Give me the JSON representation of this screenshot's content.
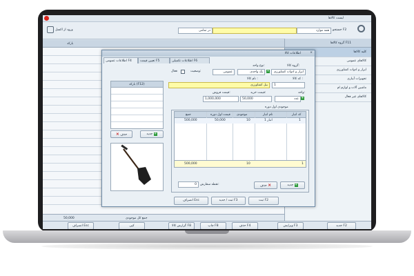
{
  "window": {
    "title": "لیست کالاها"
  },
  "toolbar": {
    "search_label": "جستجو F2",
    "search_scope": "همه موارد",
    "search_filter": "در تمامی",
    "entry_label": "ورود از اکسل"
  },
  "grid": {
    "headers": [
      "بارکد"
    ]
  },
  "categories": {
    "title": "گروه کالاها F11",
    "items": [
      "کلیه کالاها",
      "کالاهای عمومی",
      "ابزار و ادوات کشاورزی",
      "تجهیزات آبیاری",
      "ماشین آلات و لوازم ام",
      "کالاهای غیر فعال"
    ]
  },
  "footer": {
    "summary": "جمع کل موجودی",
    "total_value": "50,000",
    "buy_label": "قیمت فروش"
  },
  "bottom_buttons": {
    "new": "جدید F2",
    "edit": "ویرایش F3",
    "delete": "حذف F4",
    "print": "چاپ F8",
    "report": "گزارش کالا F8",
    "copy": "کپی",
    "exit": "انصراف Esc"
  },
  "dialog": {
    "title": "اطلاعات کالا",
    "tabs": [
      "اطلاعات عمومی F4",
      "تعیین قیمت F5",
      "اطلاعات تکمیلی F6"
    ],
    "group_label": "گروه کالا:",
    "group_value": "ابزار و ادوات کشاورزی",
    "type_label": "نوع واحد:",
    "type_value": "یک واحدی",
    "status_label": "وضعیت:",
    "status_value": "عمومی",
    "active_label": "فعال",
    "code_label": "کد کالا :",
    "code_value": "1",
    "name_label": "نام کالا :",
    "name_value": "بیل کشاورزی",
    "unit_label": "واحد:",
    "unit_value": "عدد",
    "buy_label": "قیمت خرید:",
    "buy_value": "50,000",
    "sell_label": "قیمت فروش:",
    "sell_value": "1,000,000",
    "stock_title": "موجودی اول دوره",
    "stock_headers": [
      "کد انبار",
      "نام انبار",
      "موجودی",
      "قیمت اول دوره",
      "جمع"
    ],
    "stock_row": [
      "1",
      "انبار 1",
      "10",
      "50,000",
      "500,000"
    ],
    "stock_sum_count": "10",
    "stock_sum_total": "500,000",
    "stock_row_count": "1",
    "order_point_label": "نقطه سفارش:",
    "order_point_value": "0",
    "add_label": "جدید",
    "remove_label": "حذف",
    "barcode_header": "بارکد (F12)",
    "barcode_add": "جدید",
    "barcode_remove": "حذف",
    "btn_save": "ثبت F2",
    "btn_save_new": "ثبت / جدید F3",
    "btn_cancel": "انصراف Esc"
  }
}
